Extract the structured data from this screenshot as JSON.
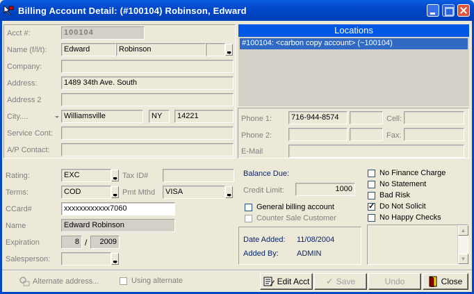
{
  "window": {
    "title": "Billing Account Detail: (#100104) Robinson, Edward"
  },
  "labels": {
    "acct": "Acct #:",
    "name": "Name (f/l/t):",
    "company": "Company:",
    "address": "Address:",
    "address2": "Address 2",
    "city": "City....",
    "service_cont": "Service Cont:",
    "ap_contact": "A/P Contact:",
    "phone1": "Phone 1:",
    "phone2": "Phone 2:",
    "cell": "Cell:",
    "fax": "Fax:",
    "email": "E-Mail",
    "rating": "Rating:",
    "tax_id": "Tax ID#",
    "terms": "Terms:",
    "pmt_mthd": "Pmt Mthd",
    "ccard": "CCard#",
    "card_name": "Name",
    "expiration": "Expiration",
    "salesperson": "Salesperson:",
    "balance_due": "Balance Due:",
    "credit_limit": "Credit Limit:",
    "date_added": "Date Added:",
    "added_by": "Added By:"
  },
  "account": {
    "acct_no": "100104",
    "first_name": "Edward",
    "last_name": "Robinson",
    "title": "",
    "company": "",
    "address": "1489 34th Ave. South",
    "address2": "",
    "city": "Williamsville",
    "state": "NY",
    "zip": "14221",
    "service_cont": "",
    "ap_contact": ""
  },
  "locations": {
    "header": "Locations",
    "items": [
      "#100104: <carbon copy account> (~100104)"
    ]
  },
  "contact": {
    "phone1": "716-944-8574",
    "phone1_ext": "",
    "phone2": "",
    "phone2_ext": "",
    "cell": "",
    "fax": "",
    "email": ""
  },
  "billing": {
    "rating": "EXC",
    "tax_id": "",
    "terms": "COD",
    "pmt_mthd": "VISA",
    "ccard": "xxxxxxxxxxxx7060",
    "card_name": "Edward Robinson",
    "exp_month": "8",
    "exp_sep": "/",
    "exp_year": "2009",
    "salesperson": "",
    "credit_limit": "1000",
    "general_billing": "General billing account",
    "counter_sale": "Counter Sale Customer"
  },
  "added": {
    "date_added": "11/08/2004",
    "added_by": "ADMIN"
  },
  "flags": {
    "no_finance_charge": "No Finance Charge",
    "no_statement": "No Statement",
    "bad_risk": "Bad Risk",
    "do_not_solicit": "Do Not Solicit",
    "no_happy_checks": "No Happy Checks"
  },
  "footer": {
    "alternate_address": "Alternate address...",
    "using_alternate": "Using alternate",
    "edit_acct": "Edit Acct",
    "save": "Save",
    "undo": "Undo",
    "close": "Close"
  }
}
